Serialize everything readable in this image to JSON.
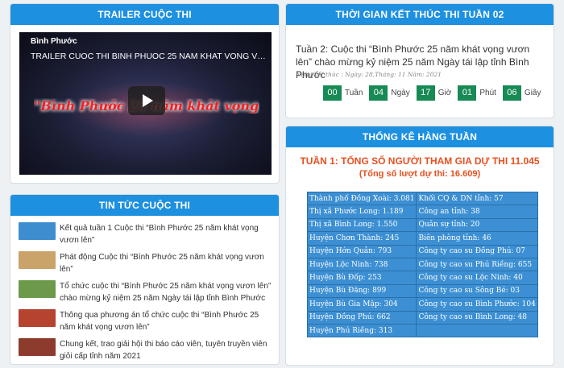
{
  "trailer": {
    "heading": "TRAILER CUỘC THI",
    "channel": "Bình Phước",
    "video_title": "TRAILER CUOC THI BINH PHUOC 25 NAM KHAT VONG VUON L...",
    "overlay_text": "\"Bình Phước 25 năm khát vọng vươn lên\""
  },
  "news": {
    "heading": "TIN TỨC CUỘC THI",
    "items": [
      {
        "text": "Kết quả tuần 1 Cuộc thi “Bình Phước 25 năm khát vọng vươn lên”",
        "thumb_color": "#3e8dcf"
      },
      {
        "text": "Phát động Cuộc thi “Bình Phước 25 năm khát vọng vươn lên”",
        "thumb_color": "#c9a36a"
      },
      {
        "text": "Tổ chức cuộc thi “Bình Phước 25 năm khát vọng vươn lên” chào mừng kỷ niệm 25 năm Ngày tái lập tỉnh Bình Phước",
        "thumb_color": "#6c9a4a"
      },
      {
        "text": "Thông qua phương án tổ chức cuộc thi “Bình Phước 25 năm khát vọng vươn lên”",
        "thumb_color": "#b5432f"
      },
      {
        "text": "Chung kết, trao giải hội thi báo cáo viên, tuyên truyền viên giỏi cấp tỉnh năm 2021",
        "thumb_color": "#8c3b2c"
      }
    ]
  },
  "countdown": {
    "heading": "THỜI GIAN KẾT THÚC THI TUẦN 02",
    "title": "Tuần 2: Cuộc thi “Bình Phước 25 năm khát vọng vươn lên” chào mừng kỷ niệm 25 năm Ngày tái lập tỉnh Bình Phước",
    "end_date": "Ngày kết thúc : Ngày: 28,Tháng: 11 Năm: 2021",
    "units": [
      {
        "value": "00",
        "label": "Tuần"
      },
      {
        "value": "04",
        "label": "Ngày"
      },
      {
        "value": "17",
        "label": "Giờ"
      },
      {
        "value": "01",
        "label": "Phút"
      },
      {
        "value": "06",
        "label": "Giây"
      }
    ],
    "box_color": "#178a55"
  },
  "stats": {
    "heading": "THỐNG KÊ HÀNG TUẦN",
    "line1": "TUẦN 1: TỔNG SỐ NGƯỜI THAM GIA DỰ THI 11.045",
    "line2": "(Tổng số lượt dự thi: 16.609)",
    "rows": [
      [
        "Thành phố Đồng Xoài: 3.081",
        "Khối CQ & DN tỉnh: 57"
      ],
      [
        "Thị xã Phước Long: 1.189",
        "Công an tỉnh: 38"
      ],
      [
        "Thị xã Bình Long: 1.550",
        "Quân sự tỉnh: 20"
      ],
      [
        "Huyện Chơn Thành: 245",
        "Biên phòng tỉnh: 46"
      ],
      [
        "Huyện Hớn Quản: 793",
        "Công ty cao su Đồng Phú: 07"
      ],
      [
        "Huyện Lộc Ninh: 738",
        "Công ty cao su Phú Riềng: 655"
      ],
      [
        "Huyện Bù Đốp: 253",
        "Công ty cao su Lộc Ninh: 40"
      ],
      [
        "Huyện Bù Đăng: 899",
        "Công ty cao su Sông Bé: 03"
      ],
      [
        "Huyện Bù Gia Mập: 304",
        "Công ty cao su Bình Phước: 104"
      ],
      [
        "Huyện Đồng Phú: 662",
        "Công ty cao su Bình Long: 48"
      ],
      [
        "Huyện Phú Riềng: 313",
        ""
      ]
    ]
  },
  "colors": {
    "header_bg": "#1e90e0",
    "accent_orange": "#e8501f",
    "table_bg": "#3c8fd3"
  }
}
